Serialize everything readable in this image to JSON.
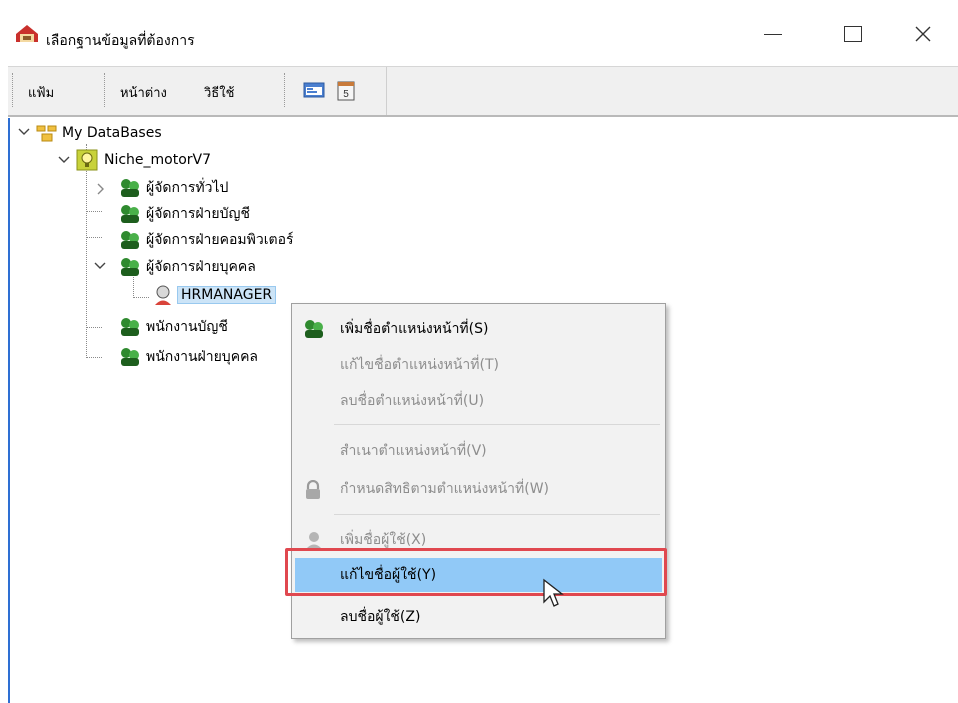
{
  "window": {
    "title": "เลือกฐานข้อมูลที่ต้องการ"
  },
  "toolbar": {
    "menu_file": "แฟ้ม",
    "menu_window": "หน้าต่าง",
    "menu_help": "วิธีใช้"
  },
  "tree": {
    "root": "My DataBases",
    "database": "Niche_motorV7",
    "groups": [
      "ผู้จัดการทั่วไป",
      "ผู้จัดการฝ่ายบัญชี",
      "ผู้จัดการฝ่ายคอมพิวเตอร์",
      "ผู้จัดการฝ่ายบุคคล",
      "พนักงานบัญชี",
      "พนักงานฝ่ายบุคคล"
    ],
    "selected_user": "HRMANAGER"
  },
  "context_menu": {
    "items": [
      "เพิ่มชื่อตำแหน่งหน้าที่(S)",
      "แก้ไขชื่อตำแหน่งหน้าที่(T)",
      "ลบชื่อตำแหน่งหน้าที่(U)",
      "สำเนาตำแหน่งหน้าที่(V)",
      "กำหนดสิทธิตามตำแหน่งหน้าที่(W)",
      "เพิ่มชื่อผู้ใช้(X)",
      "แก้ไขชื่อผู้ใช้(Y)",
      "ลบชื่อผู้ใช้(Z)"
    ]
  },
  "colors": {
    "highlight": "#91c9f7",
    "annotation": "#e0484f",
    "selection": "#cce4f7"
  }
}
